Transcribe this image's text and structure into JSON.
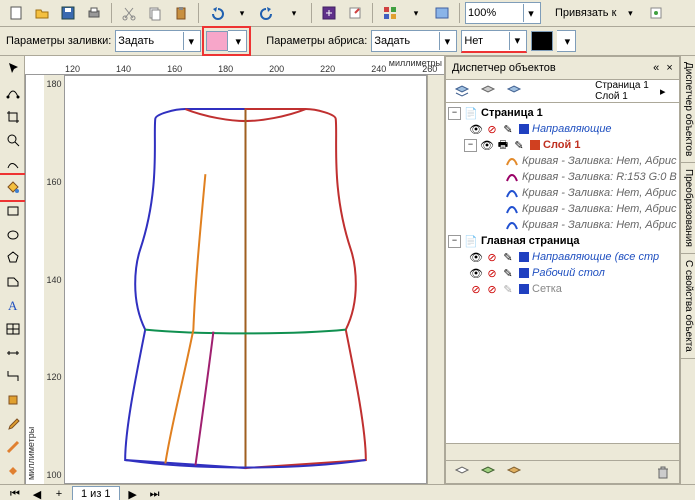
{
  "toolbar1": {
    "zoom_value": "100%",
    "snap_label": "Привязать к"
  },
  "toolbar2": {
    "fill_label": "Параметры заливки:",
    "fill_value": "Задать",
    "outline_label": "Параметры абриса:",
    "outline_value": "Задать",
    "outline_width": "Нет",
    "fill_swatch": "#f7a6c9",
    "outline_swatch": "#000000"
  },
  "ruler": {
    "h": [
      "120",
      "140",
      "160",
      "180",
      "200",
      "220",
      "240",
      "260"
    ],
    "v": [
      "180",
      "160",
      "140",
      "120",
      "100"
    ],
    "units": "миллиметры"
  },
  "statusbar": {
    "page_indicator": "1 из 1",
    "nav_prev": "◀",
    "nav_next": "▶",
    "nav_first": "⏮",
    "nav_last": "⏭",
    "add": "+"
  },
  "panel": {
    "title": "Диспетчер объектов",
    "page_current": "Страница 1",
    "layer_current": "Слой 1",
    "tree": {
      "page1": "Страница 1",
      "guides": "Направляющие",
      "layer1": "Слой 1",
      "curves": [
        "Кривая - Заливка: Нет, Абрис",
        "Кривая - Заливка: R:153 G:0 B",
        "Кривая - Заливка: Нет, Абрис",
        "Кривая - Заливка: Нет, Абрис",
        "Кривая - Заливка: Нет, Абрис"
      ],
      "curve_colors": [
        "#e38a2a",
        "#990066",
        "#2050d0",
        "#2050d0",
        "#2050d0"
      ],
      "master": "Главная страница",
      "guides_all": "Направляющие (все стр",
      "desktop": "Рабочий стол",
      "grid": "Сетка"
    }
  },
  "sidetabs": {
    "t1": "Диспетчер объектов",
    "t2": "Преобразования",
    "t3": "С свойства объекта"
  }
}
